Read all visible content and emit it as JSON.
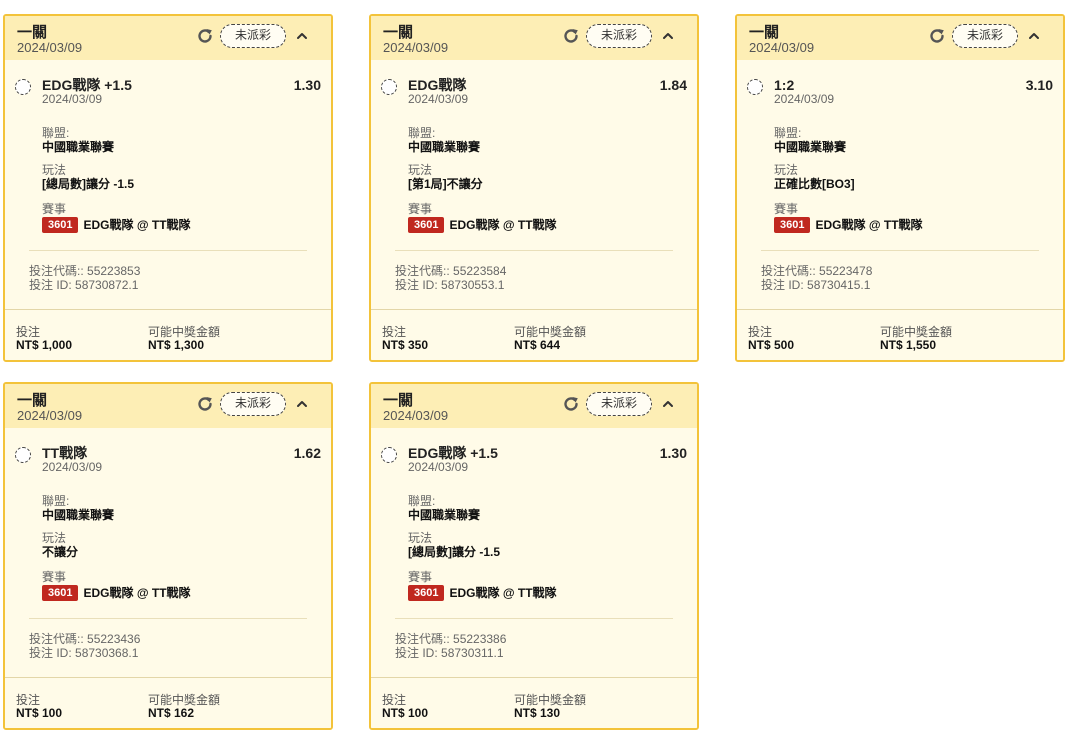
{
  "labels": {
    "league": "聯盟:",
    "bet_type": "玩法",
    "event": "賽事",
    "bet_code_prefix": "投注代碼:: ",
    "bet_id_prefix": "投注 ID: ",
    "stake": "投注",
    "potential_payout": "可能中獎金額"
  },
  "colors": {
    "card_border": "#f3c33a",
    "header_bg": "#fdeeb5",
    "body_bg": "#fffbe8",
    "event_badge": "#c0281f"
  },
  "bets": [
    {
      "type_label": "一關",
      "date": "2024/03/09",
      "status": "未派彩",
      "selection": "EDG戰隊 +1.5",
      "selection_date": "2024/03/09",
      "odds": "1.30",
      "league": "中國職業聯賽",
      "bet_type": "[總局數]讓分 -1.5",
      "event_id": "3601",
      "event_name": "EDG戰隊 @ TT戰隊",
      "bet_code": "55223853",
      "bet_id": "58730872.1",
      "stake": "NT$ 1,000",
      "potential_payout": "NT$ 1,300"
    },
    {
      "type_label": "一關",
      "date": "2024/03/09",
      "status": "未派彩",
      "selection": "EDG戰隊",
      "selection_date": "2024/03/09",
      "odds": "1.84",
      "league": "中國職業聯賽",
      "bet_type": "[第1局]不讓分",
      "event_id": "3601",
      "event_name": "EDG戰隊 @ TT戰隊",
      "bet_code": "55223584",
      "bet_id": "58730553.1",
      "stake": "NT$ 350",
      "potential_payout": "NT$ 644"
    },
    {
      "type_label": "一關",
      "date": "2024/03/09",
      "status": "未派彩",
      "selection": "1:2",
      "selection_date": "2024/03/09",
      "odds": "3.10",
      "league": "中國職業聯賽",
      "bet_type": "正確比數[BO3]",
      "event_id": "3601",
      "event_name": "EDG戰隊 @ TT戰隊",
      "bet_code": "55223478",
      "bet_id": "58730415.1",
      "stake": "NT$ 500",
      "potential_payout": "NT$ 1,550"
    },
    {
      "type_label": "一關",
      "date": "2024/03/09",
      "status": "未派彩",
      "selection": "TT戰隊",
      "selection_date": "2024/03/09",
      "odds": "1.62",
      "league": "中國職業聯賽",
      "bet_type": "不讓分",
      "event_id": "3601",
      "event_name": "EDG戰隊 @ TT戰隊",
      "bet_code": "55223436",
      "bet_id": "58730368.1",
      "stake": "NT$ 100",
      "potential_payout": "NT$ 162"
    },
    {
      "type_label": "一關",
      "date": "2024/03/09",
      "status": "未派彩",
      "selection": "EDG戰隊 +1.5",
      "selection_date": "2024/03/09",
      "odds": "1.30",
      "league": "中國職業聯賽",
      "bet_type": "[總局數]讓分 -1.5",
      "event_id": "3601",
      "event_name": "EDG戰隊 @ TT戰隊",
      "bet_code": "55223386",
      "bet_id": "58730311.1",
      "stake": "NT$ 100",
      "potential_payout": "NT$ 130"
    }
  ]
}
